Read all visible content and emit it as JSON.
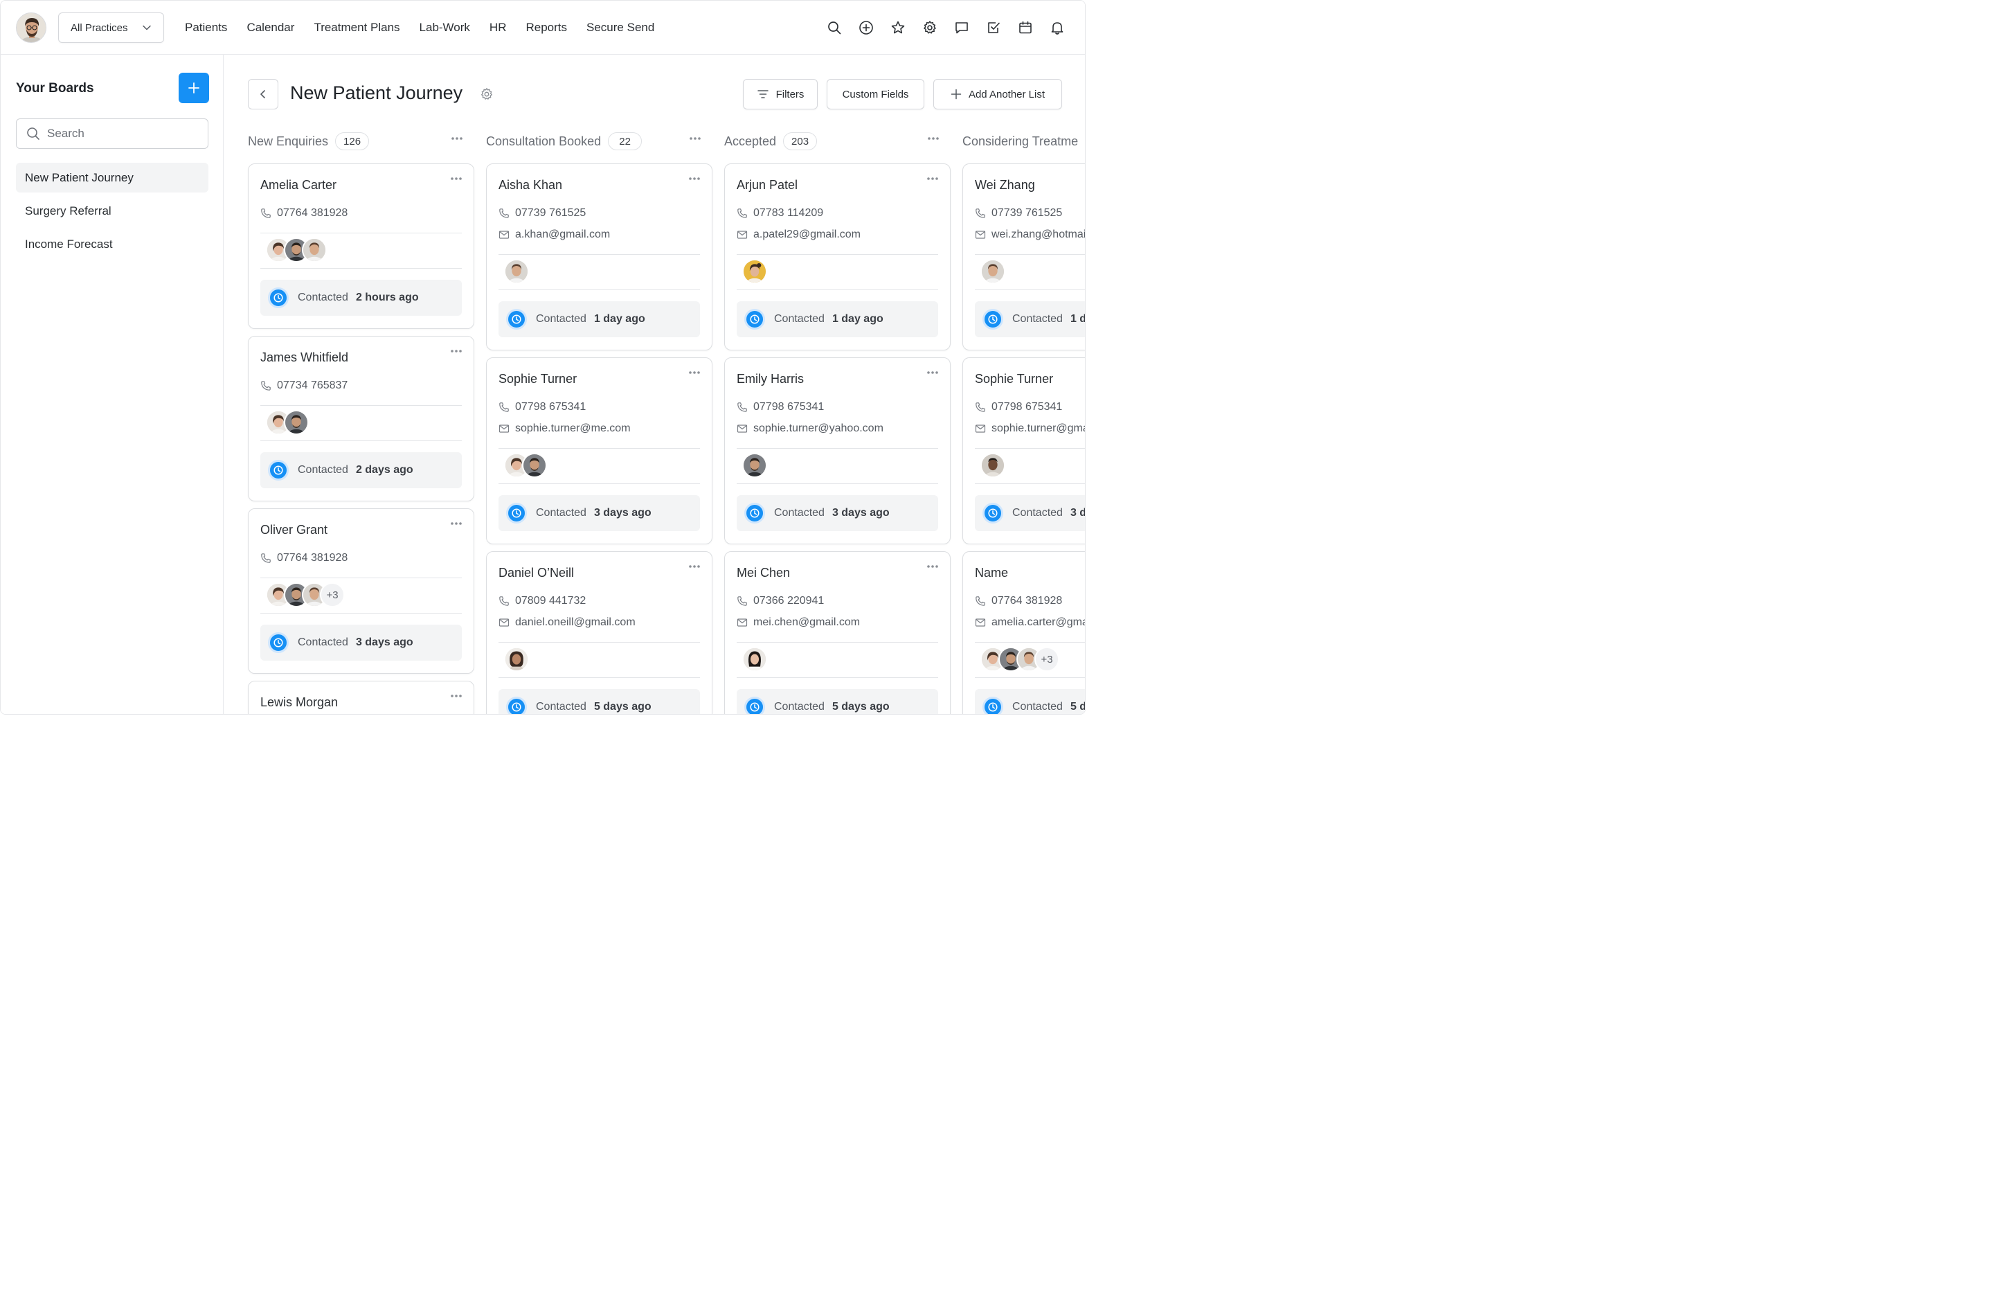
{
  "colors": {
    "accent": "#1690f5",
    "border": "#dcdee1",
    "status_bg": "#f3f4f5",
    "muted_text": "#6a6e75"
  },
  "topbar": {
    "practice_select": "All Practices",
    "nav": [
      "Patients",
      "Calendar",
      "Treatment Plans",
      "Lab-Work",
      "HR",
      "Reports",
      "Secure Send"
    ],
    "tools": [
      "search-icon",
      "plus-circle-icon",
      "star-icon",
      "gear-icon",
      "chat-icon",
      "checkbox-icon",
      "calendar-icon",
      "bell-icon"
    ]
  },
  "sidebar": {
    "title": "Your Boards",
    "search_placeholder": "Search",
    "items": [
      {
        "label": "New Patient Journey",
        "active": true
      },
      {
        "label": "Surgery Referral",
        "active": false
      },
      {
        "label": "Income Forecast",
        "active": false
      }
    ]
  },
  "board": {
    "title": "New Patient Journey",
    "filters_label": "Filters",
    "custom_fields_label": "Custom Fields",
    "add_list_label": "Add Another List"
  },
  "status_label": "Contacted",
  "columns": [
    {
      "name": "New Enquiries",
      "count": "126",
      "cards": [
        {
          "name": "Amelia Carter",
          "phone": "07764 381928",
          "avatars": [
            "f1",
            "m1",
            "m2"
          ],
          "extra": "",
          "contacted": "2 hours ago"
        },
        {
          "name": "James Whitfield",
          "phone": "07734 765837",
          "avatars": [
            "f1",
            "m1"
          ],
          "extra": "",
          "contacted": "2 days ago"
        },
        {
          "name": "Oliver Grant",
          "phone": "07764 381928",
          "avatars": [
            "f1",
            "m1",
            "m2"
          ],
          "extra": "+3",
          "contacted": "3 days ago"
        },
        {
          "name": "Lewis Morgan"
        }
      ]
    },
    {
      "name": "Consultation Booked",
      "count": "22",
      "cards": [
        {
          "name": "Aisha Khan",
          "phone": "07739 761525",
          "email": "a.khan@gmail.com",
          "avatars": [
            "m2"
          ],
          "extra": "",
          "contacted": "1 day ago"
        },
        {
          "name": "Sophie Turner",
          "phone": "07798 675341",
          "email": "sophie.turner@me.com",
          "avatars": [
            "f1",
            "m1"
          ],
          "extra": "",
          "contacted": "3 days ago"
        },
        {
          "name": "Daniel O’Neill",
          "phone": "07809 441732",
          "email": "daniel.oneill@gmail.com",
          "avatars": [
            "f2"
          ],
          "extra": "",
          "contacted": "5 days ago"
        }
      ]
    },
    {
      "name": "Accepted",
      "count": "203",
      "cards": [
        {
          "name": "Arjun Patel",
          "phone": "07783 114209",
          "email": "a.patel29@gmail.com",
          "avatars": [
            "f3"
          ],
          "extra": "",
          "contacted": "1 day ago"
        },
        {
          "name": "Emily Harris",
          "phone": "07798 675341",
          "email": "sophie.turner@yahoo.com",
          "avatars": [
            "m1"
          ],
          "extra": "",
          "contacted": "3 days ago"
        },
        {
          "name": "Mei Chen",
          "phone": "07366 220941",
          "email": "mei.chen@gmail.com",
          "avatars": [
            "f4"
          ],
          "extra": "",
          "contacted": "5 days ago"
        }
      ]
    },
    {
      "name": "Considering Treatme",
      "cards": [
        {
          "name": "Wei Zhang",
          "phone": "07739 761525",
          "email": "wei.zhang@hotmai",
          "avatars": [
            "m2"
          ],
          "extra": "",
          "contacted": "1 d"
        },
        {
          "name": "Sophie Turner",
          "phone": "07798 675341",
          "email": "sophie.turner@gma",
          "avatars": [
            "m3"
          ],
          "extra": "",
          "contacted": "3 d"
        },
        {
          "name": "Name",
          "phone": "07764 381928",
          "email": "amelia.carter@gma",
          "avatars": [
            "f1",
            "m1",
            "m2"
          ],
          "extra": "+3",
          "contacted": "5 d"
        }
      ]
    }
  ]
}
